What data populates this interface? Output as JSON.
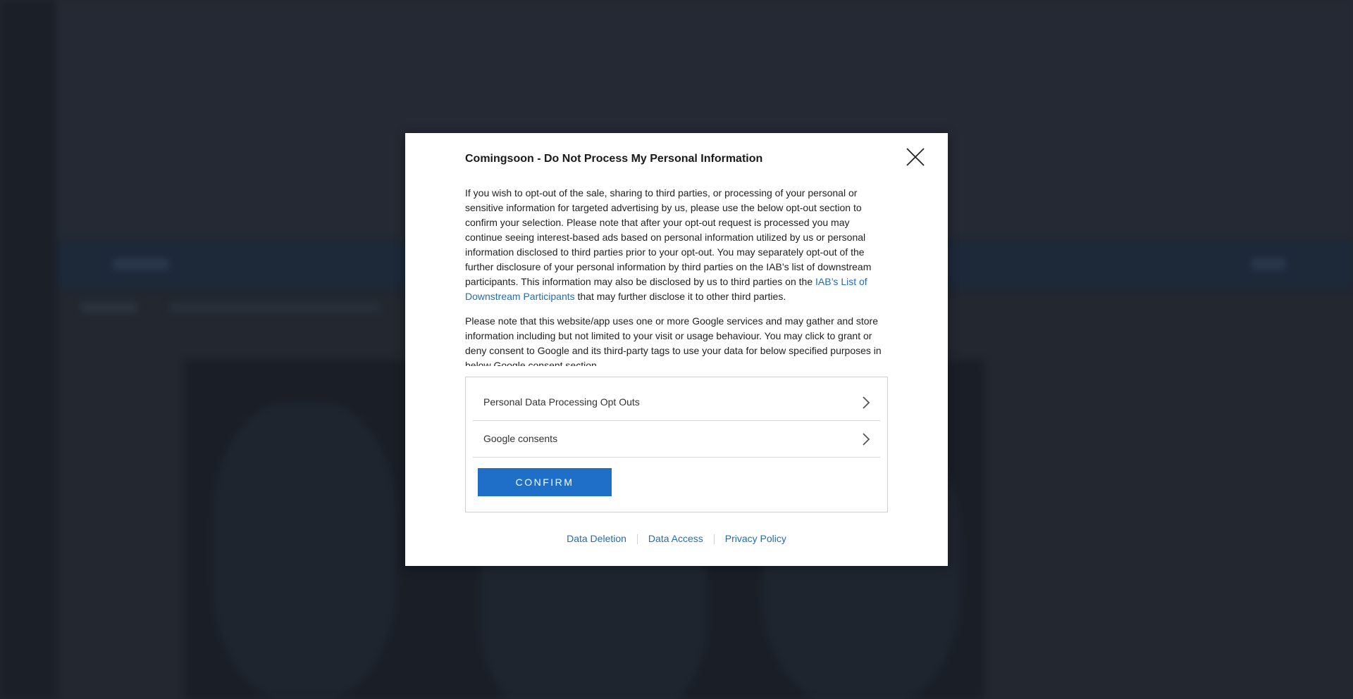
{
  "modal": {
    "title": "Comingsoon - Do Not Process My Personal Information",
    "paragraph1_text": "If you wish to opt-out of the sale, sharing to third parties, or processing of your personal or sensitive information for targeted advertising by us, please use the below opt-out section to confirm your selection. Please note that after your opt-out request is processed you may continue seeing interest-based ads based on personal information utilized by us or personal information disclosed to third parties prior to your opt-out. You may separately opt-out of the further disclosure of your personal information by third parties on the IAB’s list of downstream participants. This information may also be disclosed by us to third parties on the ",
    "paragraph1_link": "IAB’s List of Downstream Participants",
    "paragraph1_after": " that may further disclose it to other third parties.",
    "paragraph2_text": "Please note that this website/app uses one or more Google services and may gather and store information including but not limited to your visit or usage behaviour. You may click to grant or deny consent to Google and its third-party tags to use your data for below specified purposes in below Google consent section.",
    "options": [
      {
        "label": "Personal Data Processing Opt Outs",
        "icon": "chevron-right-icon"
      },
      {
        "label": "Google consents",
        "icon": "chevron-right-icon"
      }
    ],
    "confirm_label": "CONFIRM",
    "footer_links": [
      "Data Deletion",
      "Data Access",
      "Privacy Policy"
    ],
    "close_icon": "close-icon"
  },
  "colors": {
    "accent": "#1f6fc9",
    "link": "#1f6cb8",
    "background_dim": "#272d36"
  }
}
